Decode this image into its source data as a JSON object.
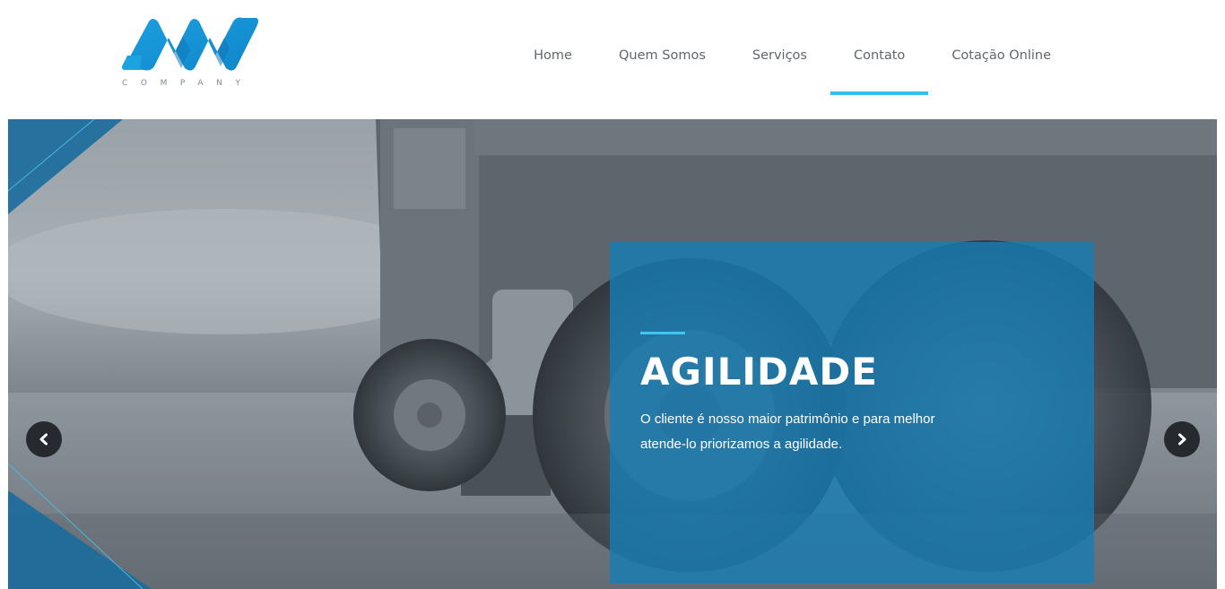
{
  "brand": {
    "icon": "aw-logo-icon",
    "tagline": "COMPANY",
    "color": "#1aa3e0"
  },
  "nav": {
    "items": [
      {
        "label": "Home"
      },
      {
        "label": "Quem Somos"
      },
      {
        "label": "Serviços"
      },
      {
        "label": "Contato"
      },
      {
        "label": "Cotação Online"
      }
    ],
    "active_label": "Contato",
    "accent_color": "#33c0ef"
  },
  "slider": {
    "background": "truck-photo",
    "title": "AGILIDADE",
    "text": "O cliente é nosso maior patrimônio e para melhor atende-lo priorizamos a agilidade.",
    "prev_icon": "chevron-left-icon",
    "next_icon": "chevron-right-icon",
    "overlay_color": "#167db4"
  }
}
